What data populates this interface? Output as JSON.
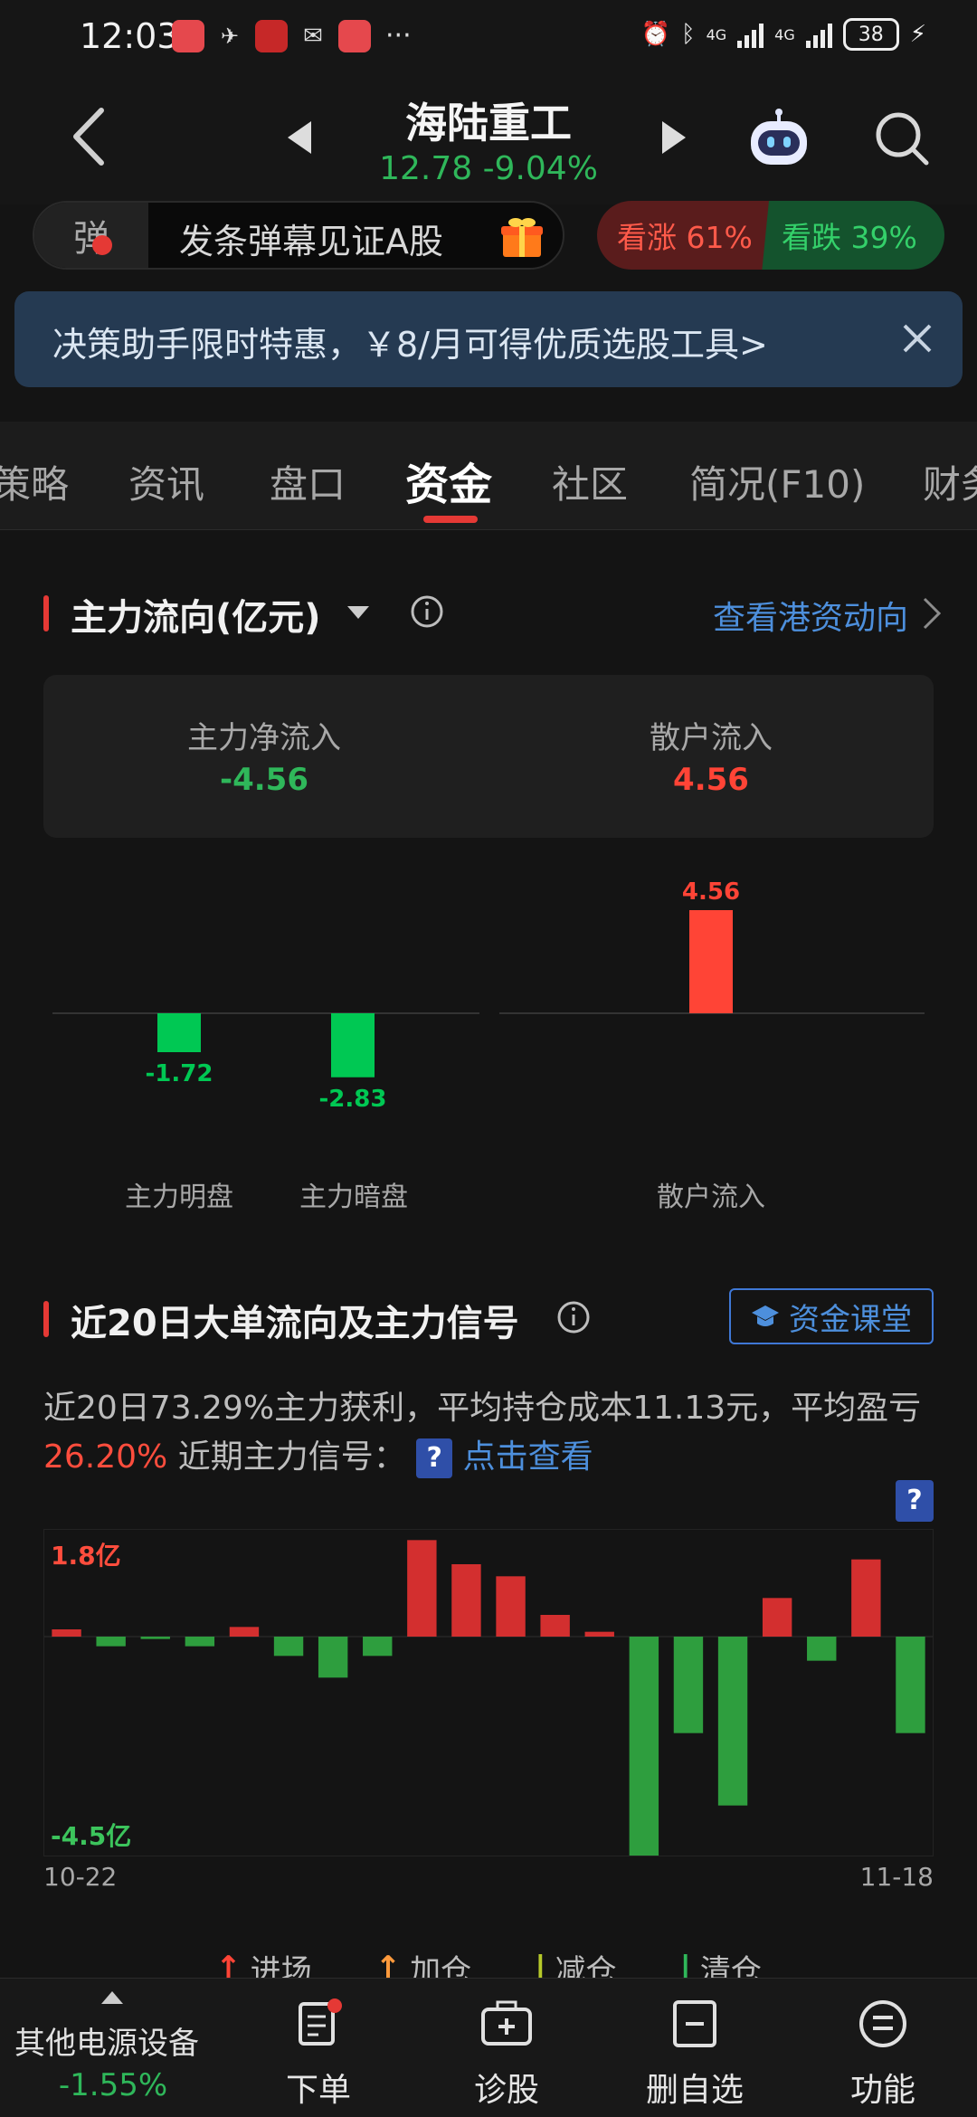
{
  "status_bar": {
    "time": "12:03",
    "net1": "4G",
    "net2": "4G",
    "battery": "38"
  },
  "header": {
    "stock_name": "海陆重工",
    "price": "12.78",
    "change": "-9.04%",
    "price_line": "12.78 -9.04%"
  },
  "danmaku": {
    "badge": "弹",
    "text": "发条弹幕见证A股"
  },
  "vote": {
    "up": "看涨 61%",
    "down": "看跌 39%",
    "up_ratio": 0.61
  },
  "banner": {
    "text": "决策助手限时特惠，￥8/月可得优质选股工具>"
  },
  "tabs": [
    {
      "label": "策略"
    },
    {
      "label": "资讯"
    },
    {
      "label": "盘口"
    },
    {
      "label": "资金"
    },
    {
      "label": "社区"
    },
    {
      "label": "简况(F10)"
    },
    {
      "label": "财务"
    }
  ],
  "main_flow": {
    "title": "主力流向(亿元)",
    "link": "查看港资动向",
    "net_inflow_label": "主力净流入",
    "net_inflow_value": "-4.56",
    "retail_label": "散户流入",
    "retail_value": "4.56"
  },
  "flow_bars": {
    "labels": [
      "主力明盘",
      "主力暗盘",
      "散户流入"
    ],
    "value_texts": [
      "-1.72",
      "-2.83",
      "4.56"
    ]
  },
  "signal_section": {
    "title": "近20日大单流向及主力信号",
    "course_button": "资金课堂",
    "desc_part1": "近20日73.29%主力获利，平均持仓成本11.13元，平均盈亏",
    "desc_pct": "26.20%",
    "desc_part2": "近期主力信号：",
    "q_badge": "?",
    "desc_link": "点击查看",
    "y_max_label": "1.8亿",
    "y_min_label": "-4.5亿",
    "x_start": "10-22",
    "x_end": "11-18",
    "legend": [
      "进场",
      "加仓",
      "减仓",
      "清仓"
    ]
  },
  "chart_data": [
    {
      "type": "bar",
      "categories": [
        "主力明盘",
        "主力暗盘",
        "散户流入"
      ],
      "values": [
        -1.72,
        -2.83,
        4.56
      ],
      "colors": [
        "#00c853",
        "#00c853",
        "#ff4436"
      ]
    },
    {
      "type": "bar",
      "title": "近20日大单流向及主力信号",
      "x_start": "10-22",
      "x_end": "11-18",
      "ylim": [
        -4.5,
        1.8
      ],
      "values": [
        0.15,
        -0.2,
        -0.05,
        -0.2,
        0.2,
        -0.4,
        -0.85,
        -0.4,
        2.0,
        1.5,
        1.25,
        0.45,
        0.1,
        -5.4,
        -2.0,
        -3.5,
        0.8,
        -0.5,
        1.6,
        -2.0
      ],
      "positive_color": "#d32f2f",
      "negative_color": "#2e9e3e"
    }
  ],
  "bottom_nav": {
    "sector_name": "其他电源设备",
    "sector_change": "-1.55%",
    "items": [
      {
        "label": "下单"
      },
      {
        "label": "诊股"
      },
      {
        "label": "删自选"
      },
      {
        "label": "功能"
      }
    ]
  },
  "colors": {
    "up": "#ff4436",
    "down": "#2fb75a",
    "accent_blue": "#4d8fdc",
    "tab_underline": "#e53935"
  }
}
